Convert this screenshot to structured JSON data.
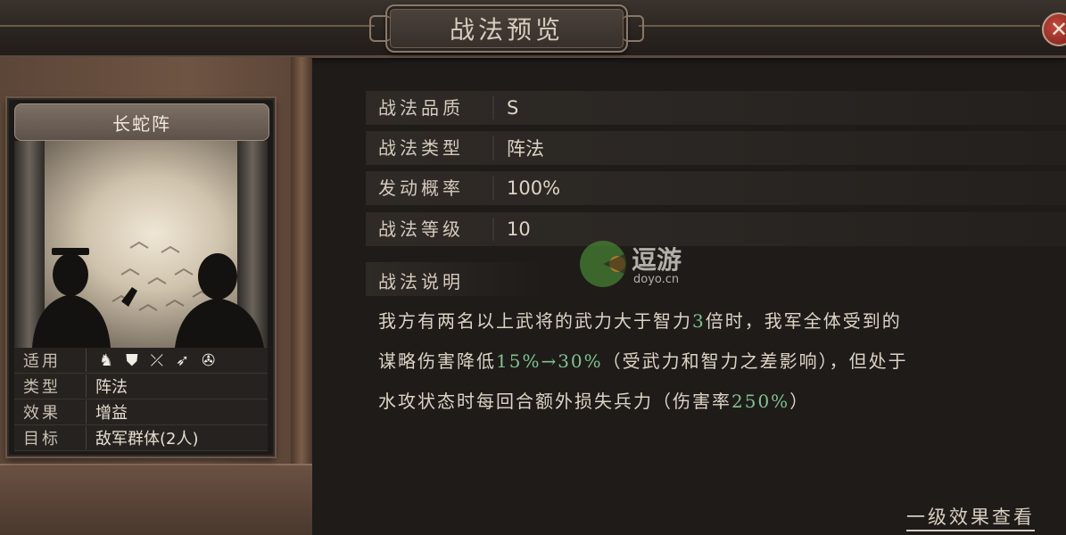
{
  "header": {
    "title": "战法预览",
    "close_icon": "close-icon"
  },
  "card": {
    "name": "长蛇阵",
    "properties": [
      {
        "key": "适用",
        "value": ""
      },
      {
        "key": "类型",
        "value": "阵法"
      },
      {
        "key": "效果",
        "value": "增益"
      },
      {
        "key": "目标",
        "value": "敌军群体(2人)"
      }
    ],
    "unit_icons": [
      "cavalry-icon",
      "shield-icon",
      "bow-icon",
      "spear-icon",
      "chariot-icon"
    ]
  },
  "info": {
    "rows": [
      {
        "key": "战法品质",
        "value": "S"
      },
      {
        "key": "战法类型",
        "value": "阵法"
      },
      {
        "key": "发动概率",
        "value": "100%"
      },
      {
        "key": "战法等级",
        "value": "10"
      }
    ],
    "desc_label": "战法说明",
    "desc": {
      "l1a": "我方有两名以上武将的武力大于智力",
      "l1b": "3",
      "l1c": "倍时，我军全体受到的",
      "l2a": "谋略伤害降低",
      "l2b": "15%→30%",
      "l2c": "（受武力和智力之差影响），但处于",
      "l3a": "水攻状态时每回合额外损失兵力（伤害率",
      "l3b": "250%",
      "l3c": "）"
    },
    "link": "一级效果查看"
  },
  "watermark": {
    "text": "逗游",
    "sub": "doyo.cn"
  },
  "colors": {
    "accent_green": "#7fc38f",
    "frame_brown": "#6e5443",
    "close_red": "#c2493e"
  }
}
